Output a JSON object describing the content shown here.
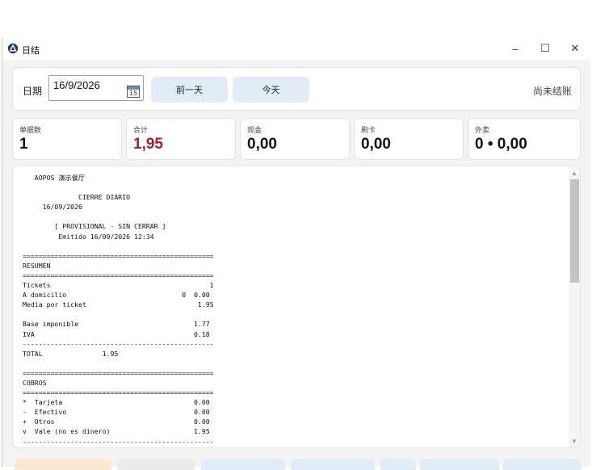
{
  "window": {
    "title": "日结",
    "controls": {
      "minimize": "–",
      "maximize": "☐",
      "close": "✕"
    }
  },
  "date_bar": {
    "label": "日期",
    "date_value": "16/9/2026",
    "calendar_number": "15",
    "prev_day": "前一天",
    "today": "今天",
    "status": "尚未结账"
  },
  "stats": [
    {
      "label": "单据数",
      "value": "1"
    },
    {
      "label": "合计",
      "value": "1,95"
    },
    {
      "label": "现金",
      "value": "0,00"
    },
    {
      "label": "刷卡",
      "value": "0,00"
    },
    {
      "label": "外卖",
      "value": "0 • 0,00"
    }
  ],
  "report": {
    "lines": [
      "   AOPOS 演示餐厅",
      "",
      "              CIERRE DIARIO",
      "     16/09/2026",
      "",
      "        [ PROVISIONAL · SIN CERRAR ]",
      "         Emitido 16/09/2026 12:34",
      "",
      "================================================",
      "RESUMEN",
      "================================================",
      "Tickets                                        1",
      "A domicilio                             0  0.00",
      "Media por ticket                            1.95",
      "",
      "Base imponible                             1.77",
      "IVA                                        0.18",
      "------------------------------------------------",
      "TOTAL               1.95",
      "",
      "================================================",
      "COBROS",
      "================================================",
      "*  Tarjeta                                 0.00",
      "-  Efectivo                                0.00",
      "+  Otros                                   0.00",
      "v  Vale (no es dinero)                     1.95",
      "------------------------------------------------"
    ]
  },
  "scrollbar": {
    "up": "▲",
    "down": "▼"
  },
  "colors": {
    "accent_red": "#a11f2b",
    "soft_button": "#e1ecf7",
    "bottom_orange": "#fde8d4",
    "bottom_blue": "#e1ecf7"
  }
}
